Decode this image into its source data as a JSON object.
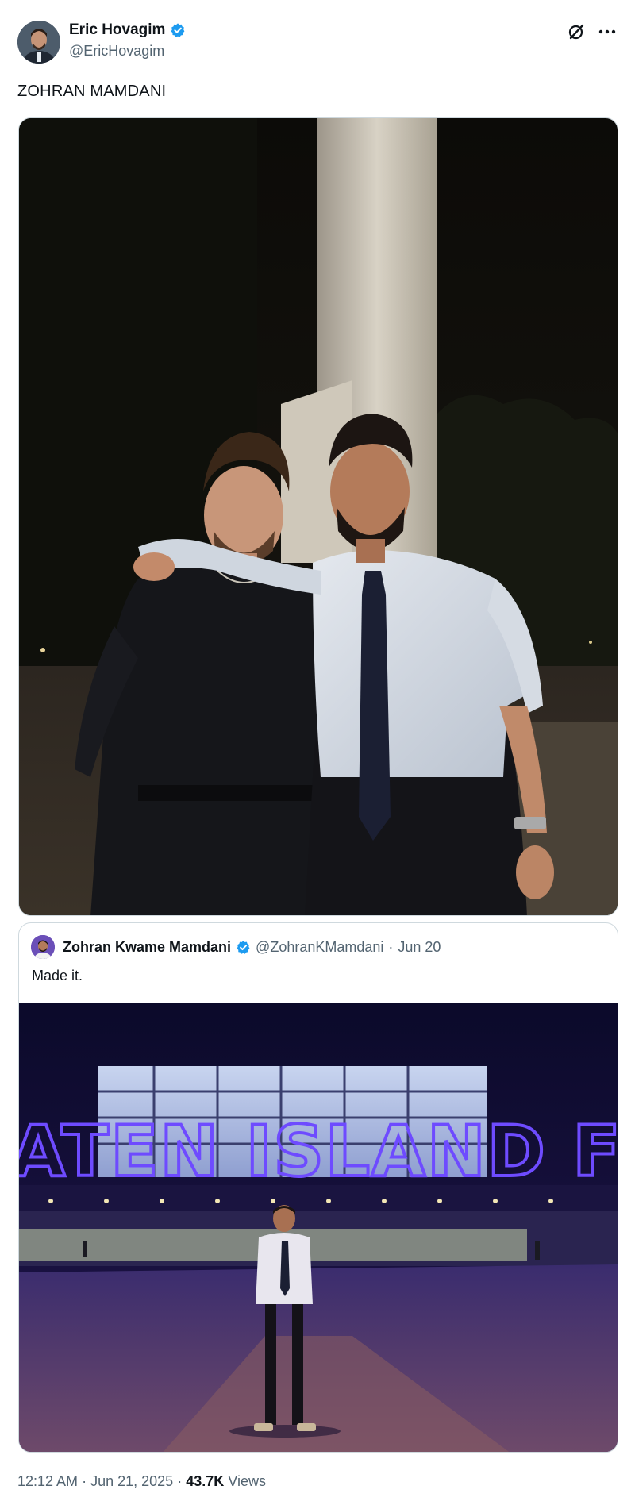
{
  "author": {
    "display_name": "Eric Hovagim",
    "handle": "@EricHovagim",
    "verified": true
  },
  "tweet": {
    "text": "ZOHRAN MAMDANI"
  },
  "quoted_tweet": {
    "display_name": "Zohran Kwame Mamdani",
    "handle": "@ZohranKMamdani",
    "separator": "·",
    "date": "Jun 20",
    "text": "Made it.",
    "sign_text": "ATEN ISLAND FERR"
  },
  "meta": {
    "time": "12:12 AM",
    "dot1": "·",
    "date": "Jun 21, 2025",
    "dot2": "·",
    "views_count": "43.7K",
    "views_label": "Views"
  },
  "icons": {
    "verified": "verified-badge-icon",
    "grok": "grok-icon",
    "more": "more-icon"
  },
  "colors": {
    "verified_blue": "#1d9bf0",
    "secondary_text": "#536471",
    "sign_neon": "#5b3bff"
  }
}
